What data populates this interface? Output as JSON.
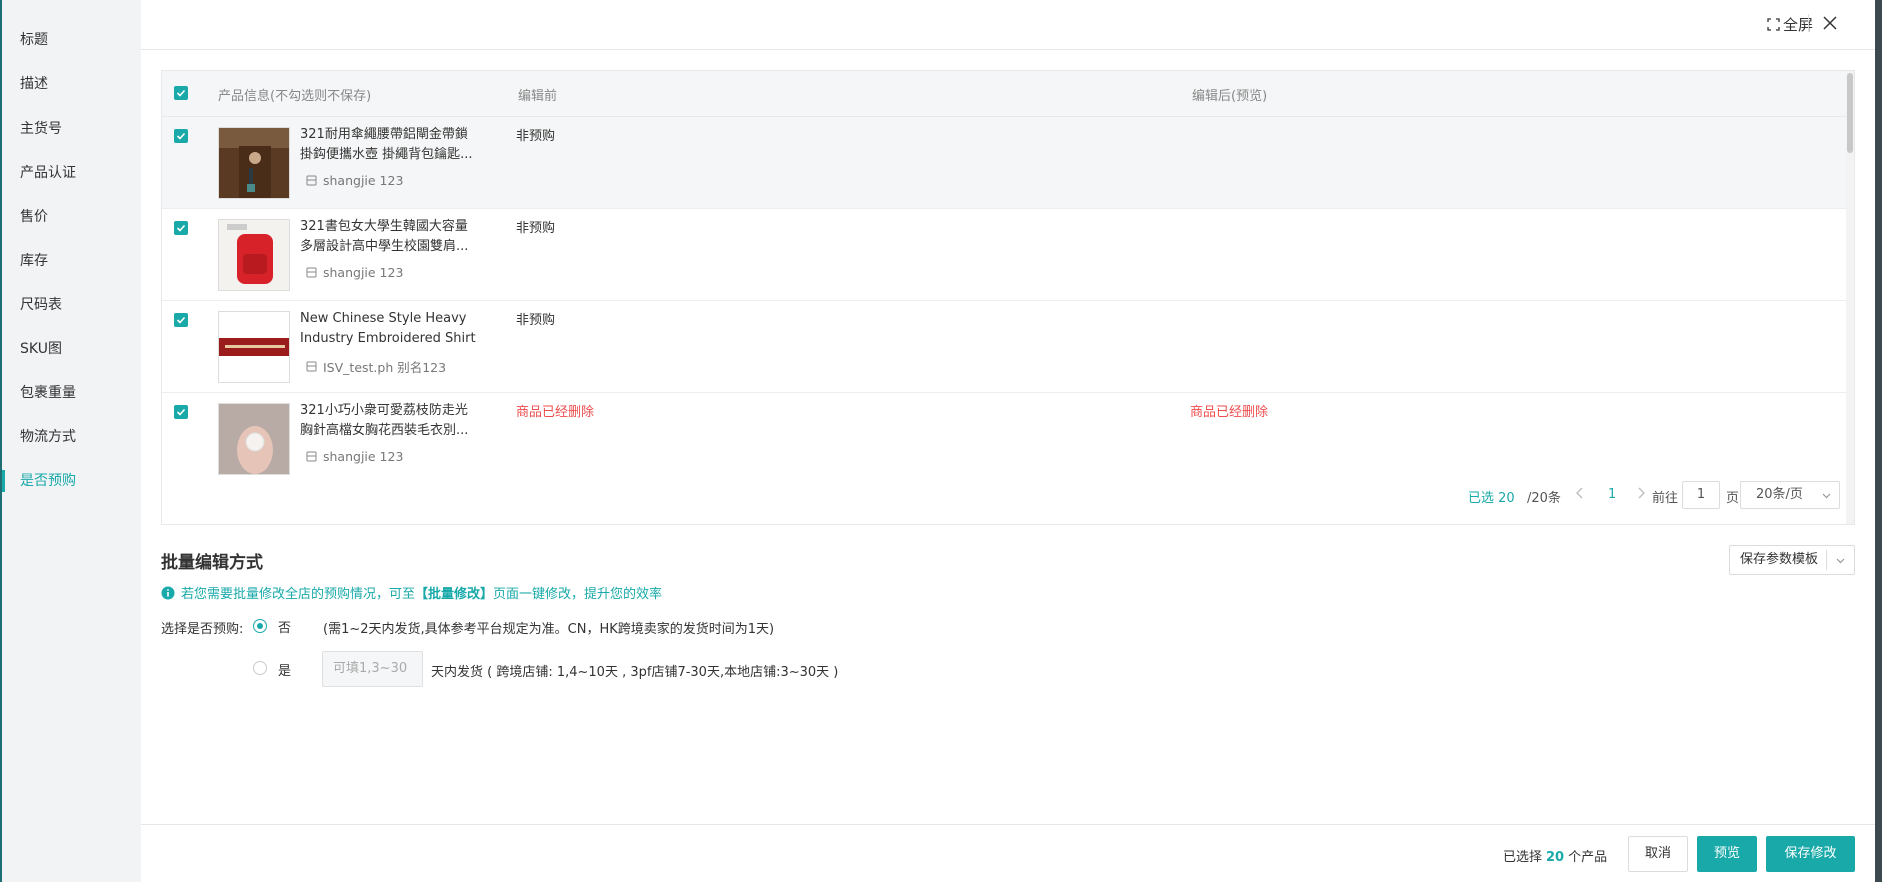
{
  "sidebar": {
    "items": [
      {
        "label": "标题"
      },
      {
        "label": "描述"
      },
      {
        "label": "主货号"
      },
      {
        "label": "产品认证"
      },
      {
        "label": "售价"
      },
      {
        "label": "库存"
      },
      {
        "label": "尺码表"
      },
      {
        "label": "SKU图"
      },
      {
        "label": "包裹重量"
      },
      {
        "label": "物流方式"
      },
      {
        "label": "是否预购"
      }
    ],
    "active_index": 10
  },
  "header": {
    "fullscreen_label": "全屏"
  },
  "table": {
    "columns": {
      "product": "产品信息(不勾选则不保存)",
      "before": "编辑前",
      "after": "编辑后(预览)"
    },
    "rows": [
      {
        "title": "321耐用傘繩腰帶鋁閘金帶鎖掛鈎便攜水壺 掛繩背包鑰匙...",
        "store": "shangjie 123",
        "before": "非预购",
        "after": "",
        "thumb": "jacket-photo"
      },
      {
        "title": "321書包女大學生韓國大容量多層設計高中學生校園雙肩...",
        "store": "shangjie 123",
        "before": "非预购",
        "after": "",
        "thumb": "red-backpack-photo"
      },
      {
        "title": "New Chinese Style Heavy Industry Embroidered Shirt ...",
        "store": "ISV_test.ph 别名123",
        "before": "非预购",
        "after": "",
        "thumb": "red-banner-photo"
      },
      {
        "title": "321小巧小衆可愛荔枝防走光胸針高檔女胸花西裝毛衣別...",
        "store": "shangjie 123",
        "before": "商品已经删除",
        "after": "商品已经删除",
        "thumb": "hand-pin-photo"
      }
    ]
  },
  "pagination": {
    "selected_prefix": "已选",
    "selected": "20",
    "total_text": "/20条",
    "current_page": "1",
    "goto_label": "前往",
    "page_input": "1",
    "page_unit": "页",
    "page_size": "20条/页"
  },
  "batch": {
    "title": "批量编辑方式",
    "template_button": "保存参数模板",
    "tip_prefix": "若您需要批量修改全店的预购情况，可至",
    "tip_link": "【批量修改】",
    "tip_suffix": "页面一键修改，提升您的效率",
    "question_label": "选择是否预购:",
    "option_no": "否",
    "option_no_desc": "(需1~2天内发货,具体参考平台规定为准。CN，HK跨境卖家的发货时间为1天)",
    "option_yes": "是",
    "days_placeholder": "可填1,3~30",
    "option_yes_desc": "天内发货 ( 跨境店铺: 1,4~10天 , 3pf店铺7-30天,本地店铺:3~30天 )",
    "selected_option": "no"
  },
  "footer": {
    "selected_prefix": "已选择",
    "selected_count": "20",
    "selected_suffix": "个产品",
    "cancel": "取消",
    "preview": "预览",
    "save": "保存修改"
  },
  "colors": {
    "accent": "#19a9a9",
    "danger": "#ee4d4d"
  }
}
